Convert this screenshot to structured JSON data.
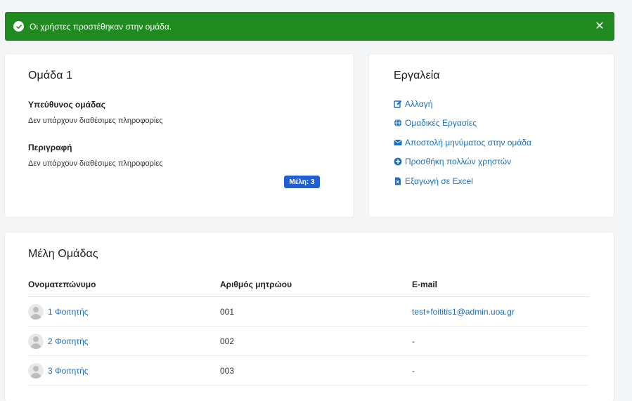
{
  "alert": {
    "message": "Οι χρήστες προστέθηκαν στην ομάδα.",
    "icon": "check-circle-icon",
    "close_symbol": "✕",
    "color": "#1f8a1f"
  },
  "group": {
    "title": "Ομάδα 1",
    "leader_label": "Υπεύθυνος ομάδας",
    "leader_value": "Δεν υπάρχουν διαθέσιμες πληροφορίες",
    "description_label": "Περιγραφή",
    "description_value": "Δεν υπάρχουν διαθέσιμες πληροφορίες",
    "members_badge": "Μέλη: 3"
  },
  "tools": {
    "title": "Εργαλεία",
    "items": [
      {
        "label": "Αλλαγή",
        "icon": "edit-icon"
      },
      {
        "label": "Ομαδικές Εργασίες",
        "icon": "globe-icon"
      },
      {
        "label": "Αποστολή μηνύματος στην ομάδα",
        "icon": "envelope-icon"
      },
      {
        "label": "Προσθήκη πολλών χρηστών",
        "icon": "plus-circle-icon"
      },
      {
        "label": "Εξαγωγή σε Excel",
        "icon": "excel-file-icon"
      }
    ]
  },
  "members": {
    "title": "Μέλη Ομάδας",
    "columns": [
      "Ονοματεπώνυμο",
      "Αριθμός μητρώου",
      "E-mail"
    ],
    "rows": [
      {
        "name": "1 Φοιτητής",
        "id": "001",
        "email": "test+foititis1@admin.uoa.gr"
      },
      {
        "name": "2 Φοιτητής",
        "id": "002",
        "email": "-"
      },
      {
        "name": "3 Φοιτητής",
        "id": "003",
        "email": "-"
      }
    ]
  }
}
